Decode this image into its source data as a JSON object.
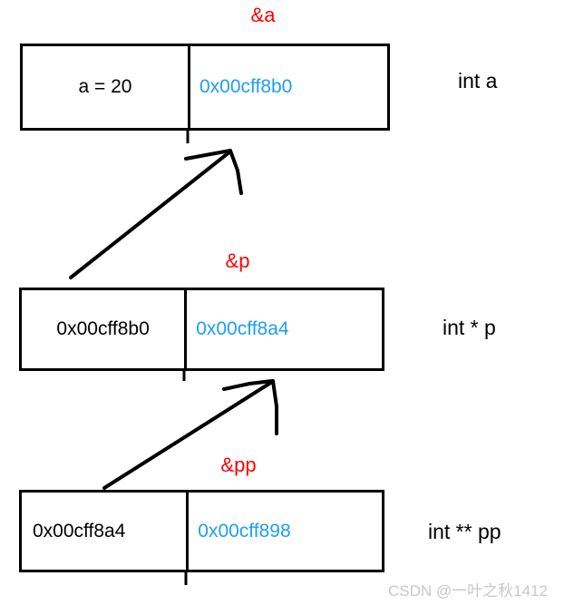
{
  "diagram": {
    "title_note": "pointer-to-pointer memory layout diagram",
    "colors": {
      "address_text": "#1E9EF5",
      "label_text": "#FF0000",
      "box_border": "#000000",
      "value_text": "#000000",
      "watermark": "#C8C8C8"
    },
    "blocks": [
      {
        "id": "block-a",
        "value": "a = 20",
        "address": "0x00cff8b0",
        "address_label": "&a",
        "type_label": "int a"
      },
      {
        "id": "block-p",
        "value": "0x00cff8b0",
        "address": "0x00cff8a4",
        "address_label": "&p",
        "type_label": "int * p"
      },
      {
        "id": "block-pp",
        "value": "0x00cff8a4",
        "address": "0x00cff898",
        "address_label": "&pp",
        "type_label": "int ** pp"
      }
    ],
    "arrows": [
      {
        "id": "arrow-p-to-a",
        "from": "block-p value cell",
        "to": "block-a address cell"
      },
      {
        "id": "arrow-pp-to-p",
        "from": "block-pp value cell",
        "to": "block-p address cell"
      }
    ]
  },
  "watermark": {
    "text": "CSDN @一叶之秋1412"
  }
}
